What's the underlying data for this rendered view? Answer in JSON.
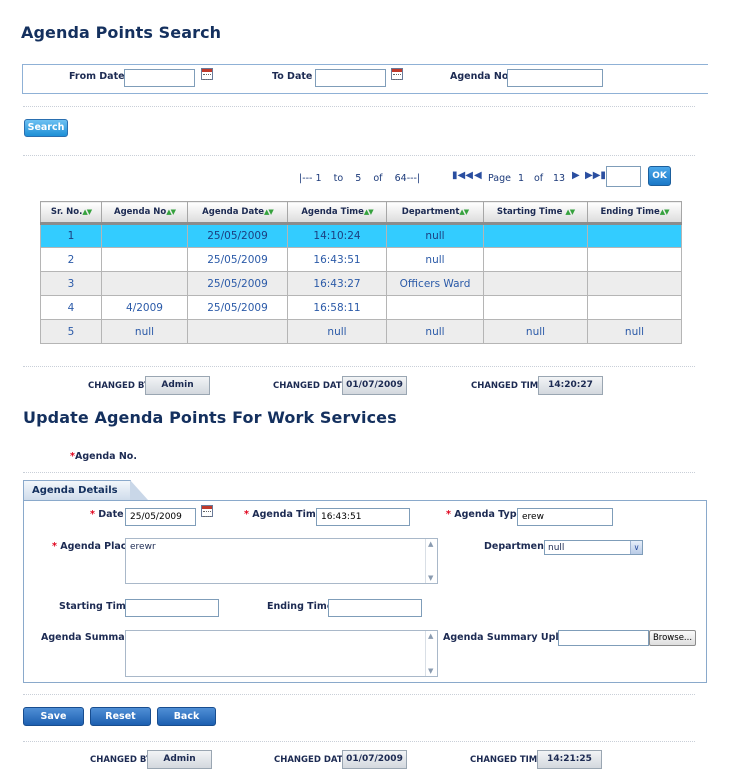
{
  "search": {
    "title": "Agenda Points Search",
    "from_date_label": "From Date",
    "to_date_label": "To Date",
    "agenda_no_label": "Agenda No.",
    "from_date_value": "",
    "to_date_value": "",
    "agenda_no_value": "",
    "search_button": "Search"
  },
  "pager": {
    "range_text": "|--- 1    to    5    of    64---|",
    "page_label": "Page",
    "current_page": "1",
    "of_label": "of",
    "total_pages": "13",
    "goto_value": "",
    "ok_button": "OK"
  },
  "grid": {
    "columns": [
      "Sr. No.",
      "Agenda No",
      "Agenda Date",
      "Agenda Time",
      "Department",
      "Starting Time",
      "Ending Time"
    ],
    "rows": [
      [
        "1",
        "",
        "25/05/2009",
        "14:10:24",
        "null",
        "",
        ""
      ],
      [
        "2",
        "",
        "25/05/2009",
        "16:43:51",
        "null",
        "",
        ""
      ],
      [
        "3",
        "",
        "25/05/2009",
        "16:43:27",
        "Officers Ward",
        "",
        ""
      ],
      [
        "4",
        "4/2009",
        "25/05/2009",
        "16:58:11",
        "",
        "",
        ""
      ],
      [
        "5",
        "null",
        "",
        "null",
        "null",
        "null",
        "null"
      ]
    ],
    "selected_row": 0
  },
  "changed_top": {
    "changed_by_label": "CHANGED BY",
    "changed_by_value": "Admin",
    "changed_date_label": "CHANGED DATE",
    "changed_date_value": "01/07/2009",
    "changed_time_label": "CHANGED TIME",
    "changed_time_value": "14:20:27"
  },
  "update": {
    "title": "Update Agenda Points For Work Services",
    "agenda_no_label": "Agenda No.",
    "tab_label": "Agenda Details",
    "date_label": "Date",
    "date_value": "25/05/2009",
    "agenda_time_label": "Agenda Time",
    "agenda_time_value": "16:43:51",
    "agenda_type_label": "Agenda Type",
    "agenda_type_value": "erew",
    "agenda_place_label": "Agenda Place",
    "agenda_place_value": "erewr",
    "department_label": "Department",
    "department_value": "null",
    "starting_time_label": "Starting Time",
    "starting_time_value": "",
    "ending_time_label": "Ending Time",
    "ending_time_value": "",
    "agenda_summary_label": "Agenda Summary",
    "agenda_summary_value": "",
    "summary_upload_label": "Agenda Summary Upload",
    "summary_upload_value": "",
    "browse_button": "Browse...",
    "save_button": "Save",
    "reset_button": "Reset",
    "back_button": "Back"
  },
  "changed_bottom": {
    "changed_by_label": "CHANGED BY",
    "changed_by_value": "Admin",
    "changed_date_label": "CHANGED DATE",
    "changed_date_value": "01/07/2009",
    "changed_time_label": "CHANGED TIME",
    "changed_time_value": "14:21:25"
  },
  "icons": {
    "calendar": "calendar-icon",
    "sort": "sort-arrows-icon",
    "first_page": "first-page-icon",
    "prev_page": "prev-page-icon",
    "next_page": "next-page-icon",
    "last_page": "last-page-icon",
    "dropdown": "chevron-down-icon"
  },
  "colors": {
    "selected_row": "#33ccff",
    "title": "#14305e",
    "required": "#e0001b"
  }
}
